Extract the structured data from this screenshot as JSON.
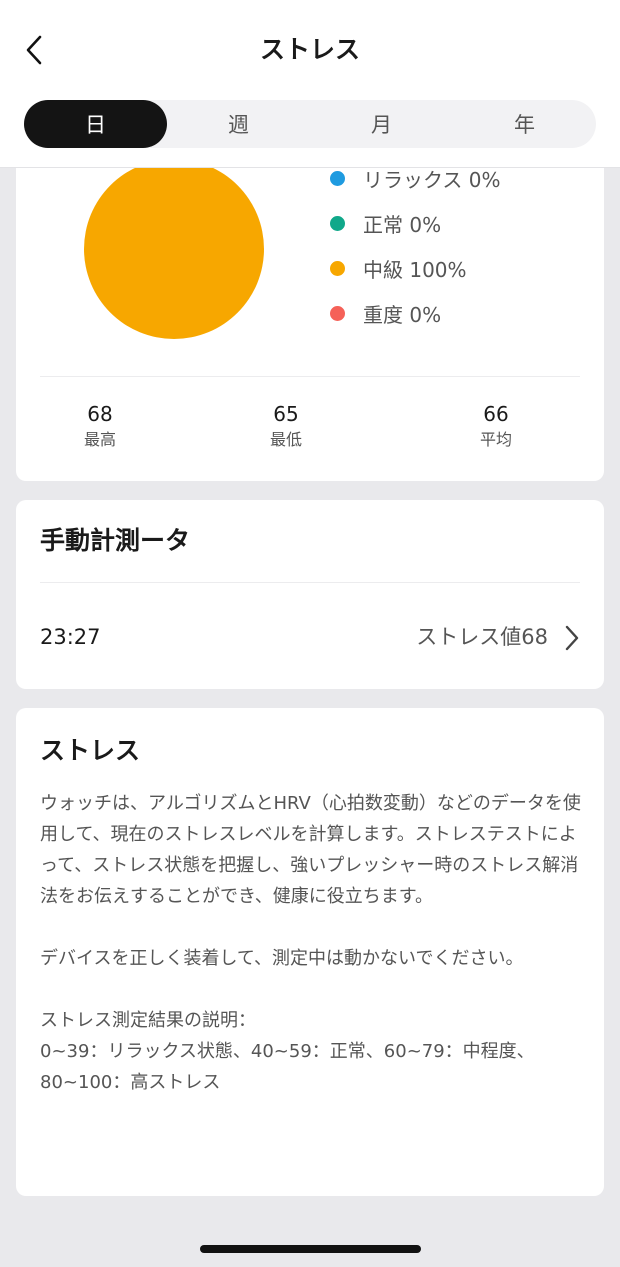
{
  "header": {
    "title": "ストレス",
    "back_icon": "chevron-left-icon"
  },
  "tabs": [
    {
      "label": "日",
      "active": true
    },
    {
      "label": "週",
      "active": false
    },
    {
      "label": "月",
      "active": false
    },
    {
      "label": "年",
      "active": false
    }
  ],
  "summary": {
    "chart_data": {
      "type": "pie",
      "categories": [
        "リラックス",
        "正常",
        "中級",
        "重度"
      ],
      "values": [
        0,
        0,
        100,
        0
      ],
      "colors": [
        "#1f9be0",
        "#10a88a",
        "#f7a700",
        "#f56158"
      ]
    },
    "legend": [
      {
        "label": "リラックス 0%",
        "color": "#1f9be0"
      },
      {
        "label": "正常 0%",
        "color": "#10a88a"
      },
      {
        "label": "中級 100%",
        "color": "#f7a700"
      },
      {
        "label": "重度 0%",
        "color": "#f56158"
      }
    ],
    "stats": [
      {
        "value": "68",
        "label": "最高"
      },
      {
        "value": "65",
        "label": "最低"
      },
      {
        "value": "66",
        "label": "平均"
      }
    ]
  },
  "manual": {
    "title": "手動計測ータ",
    "records": [
      {
        "time": "23:27",
        "value": "ストレス値68"
      }
    ]
  },
  "info": {
    "title": "ストレス",
    "paragraph1": "ウォッチは、アルゴリズムとHRV（心拍数変動）などのデータを使用して、現在のストレスレベルを計算します。ストレステストによって、ストレス状態を把握し、強いプレッシャー時のストレス解消法をお伝えすることができ、健康に役立ちます。",
    "paragraph2": "デバイスを正しく装着して、測定中は動かないでください。",
    "paragraph3_line1": "ストレス測定結果の説明：",
    "paragraph3_line2": "0~39：リラックス状態、40~59：正常、60~79：中程度、80~100：高ストレス"
  }
}
